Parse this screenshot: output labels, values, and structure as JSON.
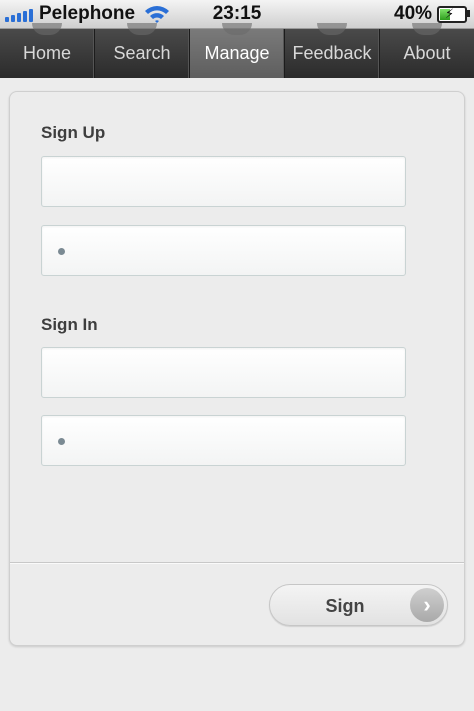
{
  "status_bar": {
    "carrier": "Pelephone",
    "time": "23:15",
    "battery_percent": "40%",
    "signal_icon": "signal-bars-icon",
    "wifi_icon": "wifi-icon",
    "battery_icon": "battery-charging-icon"
  },
  "nav": {
    "tabs": [
      {
        "label": "Home",
        "active": false
      },
      {
        "label": "Search",
        "active": false
      },
      {
        "label": "Manage",
        "active": true
      },
      {
        "label": "Feedback",
        "active": false
      },
      {
        "label": "About",
        "active": false
      }
    ]
  },
  "form": {
    "sign_up": {
      "title": "Sign Up",
      "username_value": "",
      "password_value": "•"
    },
    "sign_in": {
      "title": "Sign In",
      "username_value": "",
      "password_value": "•"
    },
    "submit_label": "Sign",
    "submit_icon": "chevron-right-icon"
  },
  "colors": {
    "nav_background": "#333333",
    "nav_active": "#6b6b6b",
    "signal_blue": "#2a6fd6",
    "battery_green": "#2e9d1c"
  }
}
